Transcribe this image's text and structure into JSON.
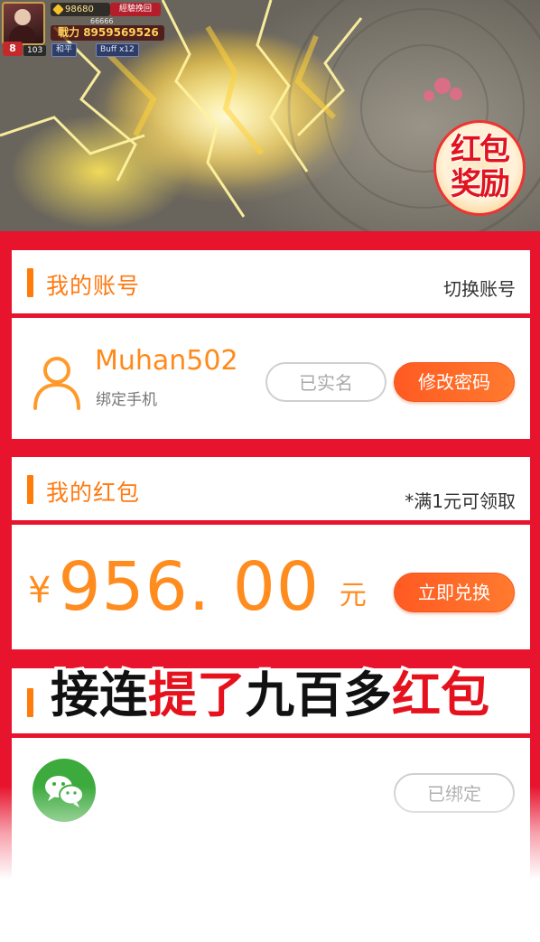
{
  "game_hud": {
    "gold": "98680",
    "exp_button": "經驗挽回",
    "sub_value": "66666",
    "power_label": "戰力",
    "power_value": "8959569526",
    "level": "8",
    "level_tag": "103",
    "mode_chip": "和平",
    "buff_chip": "Buff x12"
  },
  "reward_badge": {
    "line1": "红包",
    "line2": "奖励"
  },
  "account": {
    "title": "我的账号",
    "switch_label": "切换账号",
    "username": "Muhan502",
    "phone_label": "绑定手机",
    "verified_label": "已实名",
    "change_password_label": "修改密码"
  },
  "red_packet": {
    "title": "我的红包",
    "note": "*满1元可领取",
    "currency_symbol": "¥",
    "amount": "956. 00",
    "unit": "元",
    "redeem_label": "立即兑换"
  },
  "wechat": {
    "bound_label": "已绑定"
  },
  "caption": {
    "part1": "接连",
    "part2": "提了",
    "part3": "九百多",
    "part4": "红包"
  },
  "colors": {
    "page_bg": "#e8132d",
    "accent_orange": "#ff7a12",
    "button_orange": "#ff5a22",
    "wechat_green": "#3caa3c"
  }
}
